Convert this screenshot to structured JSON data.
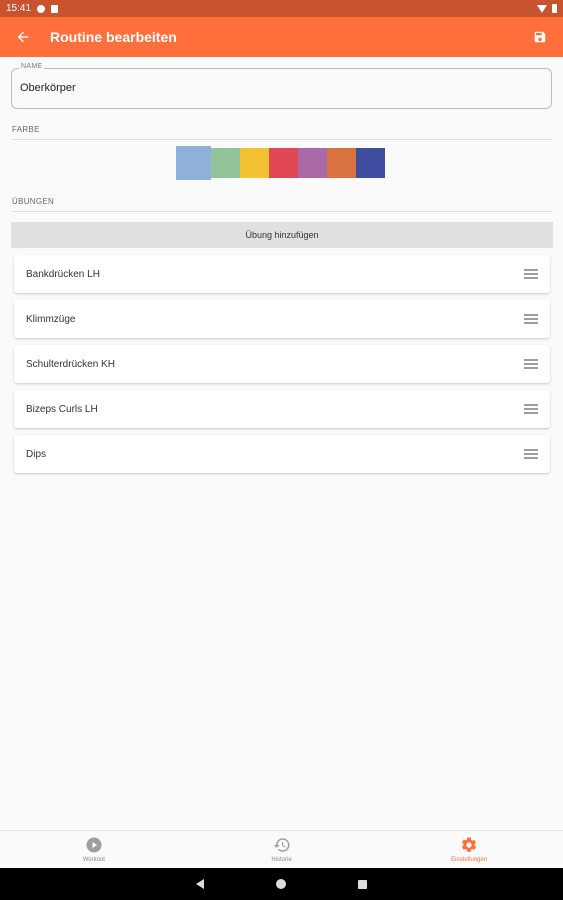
{
  "status_bar": {
    "time": "15:41"
  },
  "app_bar": {
    "title": "Routine bearbeiten"
  },
  "form": {
    "name_label": "NAME",
    "name_value": "Oberkörper",
    "color_label": "FARBE",
    "exercises_label": "ÜBUNGEN",
    "add_exercise_label": "Übung hinzufügen"
  },
  "colors": [
    "#8fb1d8",
    "#92c39d",
    "#f3c232",
    "#e14754",
    "#a96aa7",
    "#d8733f",
    "#3f4da1"
  ],
  "exercises": [
    "Bankdrücken LH",
    "Klimmzüge",
    "Schulterdrücken KH",
    "Bizeps Curls LH",
    "Dips"
  ],
  "bottom_nav": {
    "items": [
      {
        "label": "Workout",
        "icon": "play-circle-icon"
      },
      {
        "label": "Historie",
        "icon": "history-icon"
      },
      {
        "label": "Einstellungen",
        "icon": "gear-icon"
      }
    ],
    "active": 2,
    "accent": "#ff6f3c"
  }
}
